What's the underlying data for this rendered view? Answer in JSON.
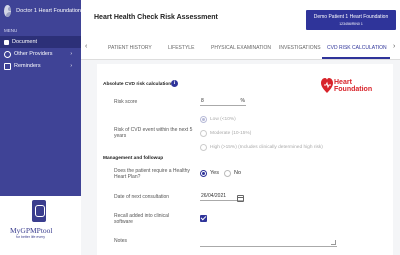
{
  "sidebar": {
    "user_name": "Doctor 1 Heart Foundation",
    "menu_label": "MENU",
    "items": [
      {
        "label": "Document",
        "icon": "document-icon",
        "active": true
      },
      {
        "label": "Other Providers",
        "icon": "providers-icon",
        "chevron": "›"
      },
      {
        "label": "Reminders",
        "icon": "reminders-icon",
        "chevron": "›"
      }
    ],
    "logo_text": "MyGPMPtool",
    "logo_tagline": "for better life every"
  },
  "header": {
    "title": "Heart Health Check Risk Assessment",
    "patient_name": "Demo Patient 1 Heart Foundation",
    "patient_id": "123456/RIN0 1"
  },
  "tabs": {
    "left_arrow": "‹",
    "right_arrow": "›",
    "items": [
      "PATIENT HISTORY",
      "LIFESTYLE",
      "PHYSICAL EXAMINATION",
      "INVESTIGATIONS",
      "CVD RISK CALCULATION"
    ],
    "active_index": 4
  },
  "form": {
    "section_risk": "Absolute CVD risk calculation",
    "info_icon": "i",
    "risk_score_label": "Risk score",
    "risk_score_value": "8",
    "risk_score_unit": "%",
    "risk_event_label": "Risk of CVD event within the next 5 years",
    "risk_options": [
      {
        "label": "Low (<10%)",
        "selected": true
      },
      {
        "label": "Moderate (10-15%)",
        "selected": false
      },
      {
        "label": "High (>15%) (Includes clinically determined high risk)",
        "selected": false
      }
    ],
    "section_mgmt": "Management and followup",
    "heart_plan_label": "Does the patient require a Healthy Heart Plan?",
    "heart_plan_yes": "Yes",
    "heart_plan_no": "No",
    "heart_plan_selected": "Yes",
    "next_consult_label": "Date of next consultation",
    "next_consult_value": "26/04/2021",
    "recall_label": "Recall added into clinical software",
    "recall_checked": true,
    "notes_label": "Notes",
    "notes_value": ""
  },
  "brand": {
    "heart_foundation_line1": "Heart",
    "heart_foundation_line2": "Foundation",
    "accent_color": "#2f349a",
    "sidebar_color": "#3f4396",
    "heart_color": "#d8232a"
  }
}
